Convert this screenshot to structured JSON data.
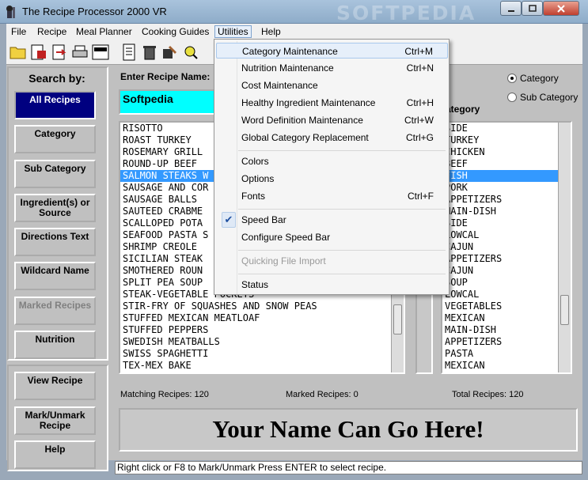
{
  "window": {
    "title": "The Recipe Processor 2000 VR",
    "watermark": "SOFTPEDIA"
  },
  "menu": [
    "File",
    "Recipe",
    "Meal Planner",
    "Cooking Guides",
    "Utilities",
    "Help"
  ],
  "search": {
    "label": "Search by:",
    "buttons": [
      "All Recipes",
      "Category",
      "Sub Category",
      "Ingredient(s) or Source",
      "Directions Text",
      "Wildcard Name",
      "Marked Recipes",
      "Nutrition"
    ],
    "bottom_buttons": [
      "View Recipe",
      "Mark/Unmark Recipe",
      "Help"
    ]
  },
  "name_entry": {
    "label": "Enter Recipe Name:",
    "value": "Softpedia"
  },
  "recipes": [
    "RISOTTO",
    "ROAST TURKEY",
    "ROSEMARY GRILL",
    "ROUND-UP BEEF",
    "SALMON STEAKS W",
    "SAUSAGE AND COR",
    "SAUSAGE BALLS",
    "SAUTEED CRABME",
    "SCALLOPED POTA",
    "SEAFOOD PASTA S",
    "SHRIMP CREOLE",
    "SICILIAN STEAK",
    "SMOTHERED ROUN",
    "SPLIT PEA SOUP",
    "STEAK-VEGETABLE POCKETS",
    "STIR-FRY OF SQUASHES AND SNOW PEAS",
    "STUFFED MEXICAN MEATLOAF",
    "STUFFED PEPPERS",
    "SWEDISH MEATBALLS",
    "SWISS SPAGHETTI",
    "TEX-MEX BAKE"
  ],
  "category": {
    "header": "ategory",
    "radio_category": "Category",
    "radio_subcategory": "Sub Category",
    "items": [
      "SIDE",
      "TURKEY",
      "CHICKEN",
      "BEEF",
      "FISH",
      "PORK",
      "APPETIZERS",
      "MAIN-DISH",
      "SIDE",
      "LOWCAL",
      "CAJUN",
      "APPETIZERS",
      "CAJUN",
      "SOUP",
      "LOWCAL",
      "VEGETABLES",
      "MEXICAN",
      "MAIN-DISH",
      "APPETIZERS",
      "PASTA",
      "MEXICAN"
    ]
  },
  "counts": {
    "matching": "Matching Recipes: 120",
    "marked": "Marked Recipes: 0",
    "total": "Total Recipes: 120"
  },
  "banner": "Your Name Can Go Here!",
  "status": "Right click or F8 to Mark/Unmark  Press ENTER to select recipe.",
  "utilities_menu": [
    {
      "label": "Category Maintenance",
      "shortcut": "Ctrl+M"
    },
    {
      "label": "Nutrition Maintenance",
      "shortcut": "Ctrl+N"
    },
    {
      "label": "Cost Maintenance",
      "shortcut": ""
    },
    {
      "label": "Healthy Ingredient Maintenance",
      "shortcut": "Ctrl+H"
    },
    {
      "label": "Word Definition Maintenance",
      "shortcut": "Ctrl+W"
    },
    {
      "label": "Global Category Replacement",
      "shortcut": "Ctrl+G"
    },
    {
      "label": "Colors",
      "shortcut": ""
    },
    {
      "label": "Options",
      "shortcut": ""
    },
    {
      "label": "Fonts",
      "shortcut": "Ctrl+F"
    },
    {
      "label": "Speed Bar",
      "shortcut": ""
    },
    {
      "label": "Configure Speed Bar",
      "shortcut": ""
    },
    {
      "label": "Quicking File Import",
      "shortcut": ""
    },
    {
      "label": "Status",
      "shortcut": ""
    }
  ],
  "colors": {
    "selected_row": "#3399ff",
    "name_box": "#00ffff",
    "active_button": "#000080"
  }
}
